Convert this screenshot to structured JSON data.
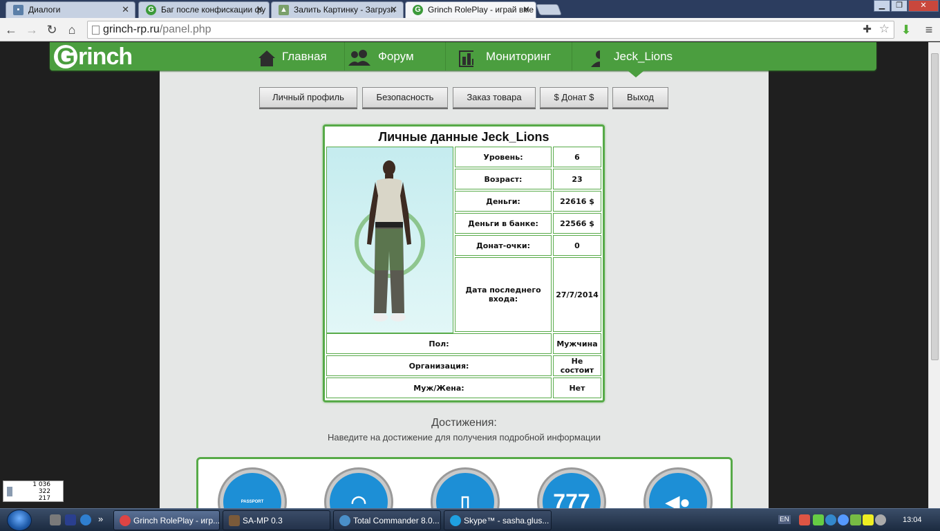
{
  "browser": {
    "tabs": [
      {
        "title": "Диалоги",
        "favicon": "chat-icon"
      },
      {
        "title": "Баг после конфискации фу",
        "favicon": "grinch-icon"
      },
      {
        "title": "Залить Картинку - Загрузи",
        "favicon": "image-icon"
      },
      {
        "title": "Grinch RolePlay - играй вме",
        "favicon": "grinch-icon"
      }
    ],
    "url_host": "grinch-rp.ru",
    "url_path": "/panel.php"
  },
  "site": {
    "logo_g": "G",
    "logo_rest": "rinch",
    "nav": [
      {
        "label": "Главная",
        "icon": "home-icon"
      },
      {
        "label": "Форум",
        "icon": "users-icon"
      },
      {
        "label": "Мониторинг",
        "icon": "chart-icon"
      },
      {
        "label": "Jeck_Lions",
        "icon": "user-icon"
      }
    ],
    "panel_buttons": [
      "Личный профиль",
      "Безопасность",
      "Заказ товара",
      "$ Донат $",
      "Выход"
    ]
  },
  "profile": {
    "title": "Личные данные Jeck_Lions",
    "rows": [
      {
        "label": "Уровень:",
        "value": "6"
      },
      {
        "label": "Возраст:",
        "value": "23"
      },
      {
        "label": "Деньги:",
        "value": "22616 $"
      },
      {
        "label": "Деньги в банке:",
        "value": "22566 $"
      },
      {
        "label": "Донат-очки:",
        "value": "0"
      },
      {
        "label": "Дата последнего входа:",
        "value": "27/7/2014"
      },
      {
        "label": "Пол:",
        "value": "Мужчина"
      },
      {
        "label": "Организация:",
        "value": "Не состоит"
      },
      {
        "label": "Муж/Жена:",
        "value": "Нет"
      }
    ]
  },
  "achievements": {
    "title": "Достижения:",
    "subtitle": "Наведите на достижение для получения подробной информации",
    "badges": [
      {
        "icon": "passport-icon",
        "text": "PASSPORT"
      },
      {
        "icon": "mask-icon",
        "text": ""
      },
      {
        "icon": "door-icon",
        "text": ""
      },
      {
        "icon": "777-icon",
        "text": "777"
      },
      {
        "icon": "fish-icon",
        "text": ""
      }
    ]
  },
  "counter_widget": {
    "line1": "1 036",
    "line2": "322",
    "line3": "217"
  },
  "taskbar": {
    "buttons": [
      "Grinch RolePlay - игр...",
      "SA-MP 0.3",
      "Total Commander 8.0...",
      "Skype™ - sasha.glus..."
    ],
    "lang": "EN",
    "clock": "13:04"
  },
  "colors": {
    "brand_green": "#4b9e3f",
    "table_border": "#57aa48",
    "badge_blue": "#1d8fd6"
  }
}
